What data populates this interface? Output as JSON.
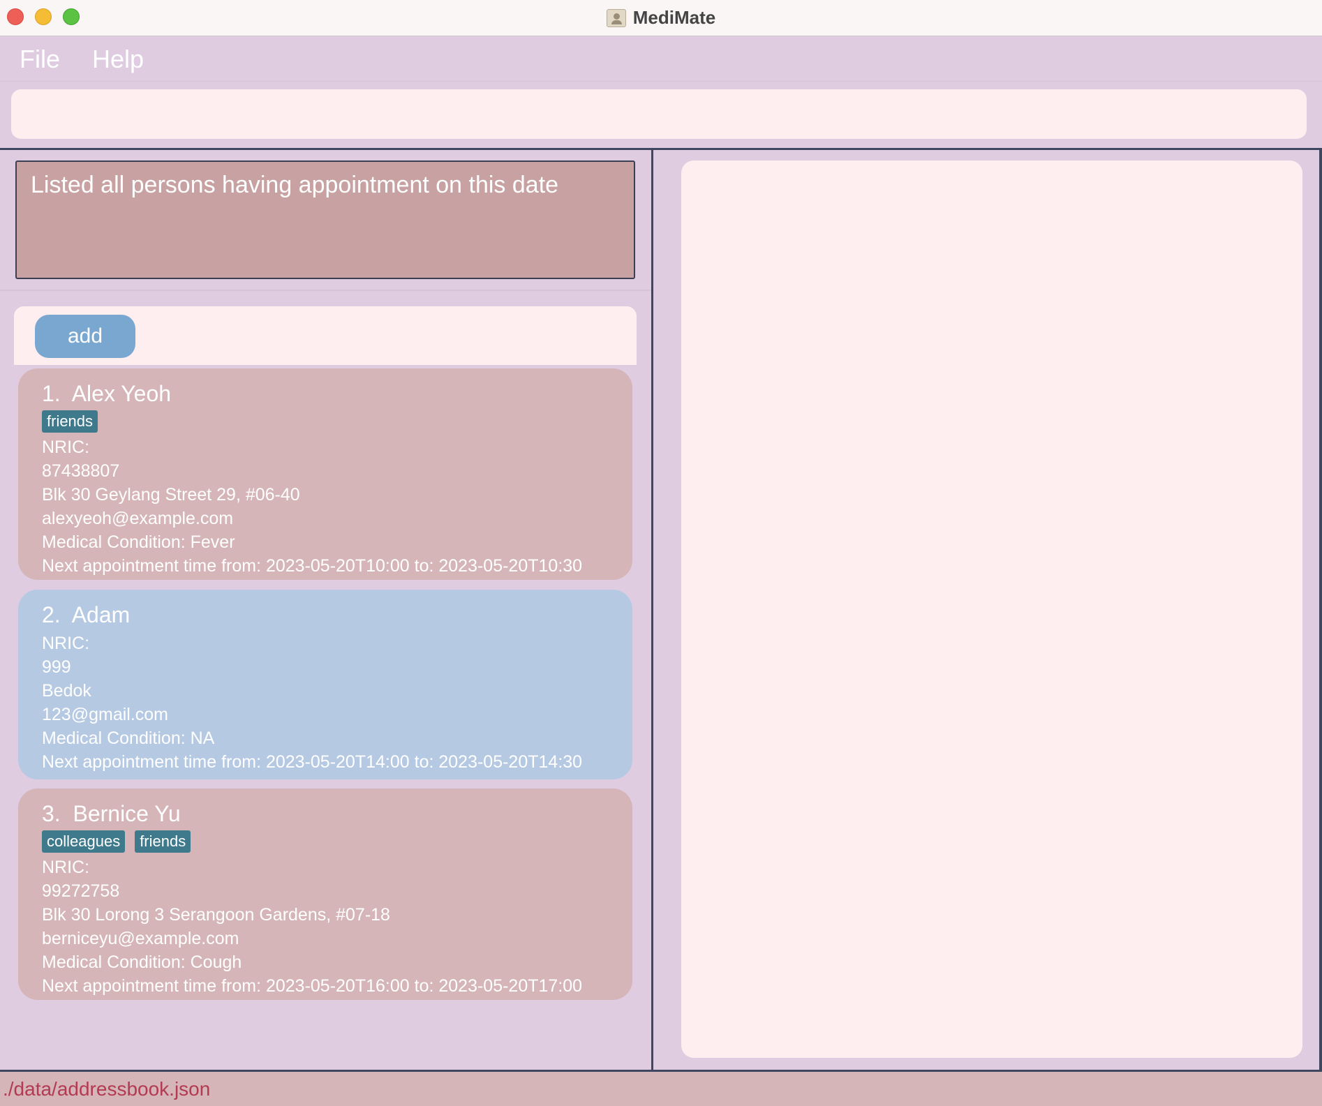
{
  "window": {
    "title": "MediMate"
  },
  "menu": {
    "file": "File",
    "help": "Help"
  },
  "command": {
    "value": "",
    "placeholder": ""
  },
  "result": {
    "message": "Listed all persons having appointment on this date"
  },
  "toolbar": {
    "add_label": "add"
  },
  "persons": [
    {
      "index": "1.",
      "name": "Alex Yeoh",
      "tags": [
        "friends"
      ],
      "nric": "NRIC:",
      "phone": "87438807",
      "address": "Blk 30 Geylang Street 29, #06-40",
      "email": "alexyeoh@example.com",
      "condition": "Medical Condition: Fever",
      "appointment": "Next appointment time from: 2023-05-20T10:00 to: 2023-05-20T10:30",
      "color": "#d5b5b7"
    },
    {
      "index": "2.",
      "name": "Adam",
      "tags": [],
      "nric": "NRIC:",
      "phone": "999",
      "address": "Bedok",
      "email": "123@gmail.com",
      "condition": "Medical Condition: NA",
      "appointment": "Next appointment time from: 2023-05-20T14:00 to: 2023-05-20T14:30",
      "color": "#b5c9e3"
    },
    {
      "index": "3.",
      "name": "Bernice Yu",
      "tags": [
        "colleagues",
        "friends"
      ],
      "nric": "NRIC:",
      "phone": "99272758",
      "address": "Blk 30 Lorong 3 Serangoon Gardens, #07-18",
      "email": "berniceyu@example.com",
      "condition": "Medical Condition: Cough",
      "appointment": "Next appointment time from: 2023-05-20T16:00 to: 2023-05-20T17:00",
      "color": "#d5b5b7"
    }
  ],
  "status": {
    "file_path": "./data/addressbook.json"
  },
  "colors": {
    "accent_tag": "#3f7a8c",
    "add_button": "#7aa7d0",
    "status_text": "#b23a52"
  }
}
